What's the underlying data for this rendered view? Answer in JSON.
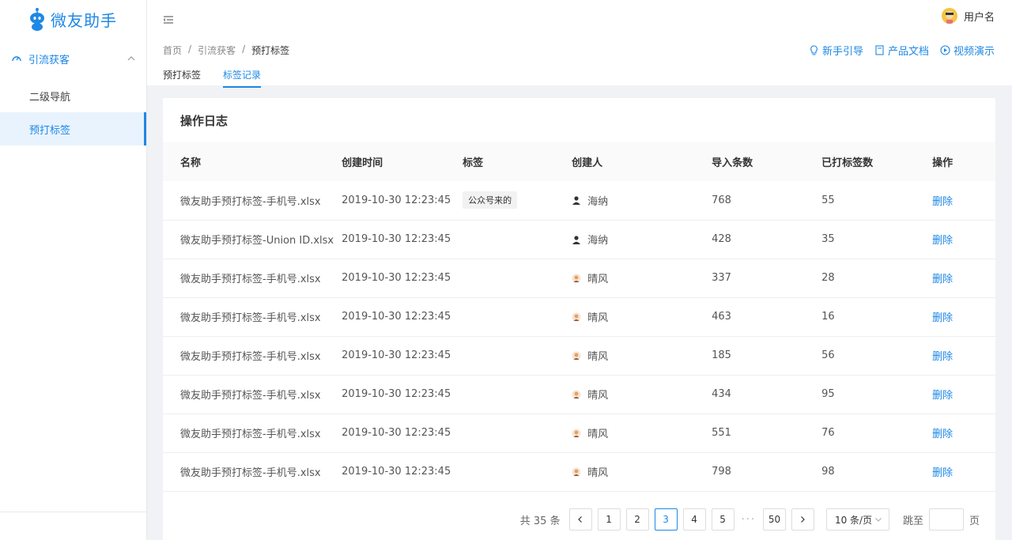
{
  "app": {
    "logo_text": "微友助手",
    "brand_color": "#1e88e5"
  },
  "sidebar": {
    "group": {
      "label": "引流获客",
      "icon": "dashboard-icon",
      "expanded": true
    },
    "items": [
      {
        "label": "二级导航",
        "active": false
      },
      {
        "label": "预打标签",
        "active": true
      }
    ]
  },
  "header": {
    "user_name": "用户名",
    "breadcrumb": [
      "首页",
      "引流获客",
      "预打标签"
    ],
    "help_links": [
      {
        "label": "新手引导",
        "icon": "lightbulb-icon"
      },
      {
        "label": "产品文档",
        "icon": "document-icon"
      },
      {
        "label": "视频演示",
        "icon": "play-icon"
      }
    ],
    "tabs": [
      {
        "label": "预打标签",
        "active": false
      },
      {
        "label": "标签记录",
        "active": true
      }
    ]
  },
  "card": {
    "title": "操作日志",
    "columns": [
      "名称",
      "创建时间",
      "标签",
      "创建人",
      "导入条数",
      "已打标签数",
      "操作"
    ],
    "rows": [
      {
        "name": "微友助手预打标签-手机号.xlsx",
        "time": "2019-10-30 12:23:45",
        "tag": "公众号来的",
        "creator": "海纳",
        "imported": "768",
        "tagged": "55",
        "action": "删除"
      },
      {
        "name": "微友助手预打标签-Union ID.xlsx",
        "time": "2019-10-30 12:23:45",
        "tag": "",
        "creator": "海纳",
        "imported": "428",
        "tagged": "35",
        "action": "删除"
      },
      {
        "name": "微友助手预打标签-手机号.xlsx",
        "time": "2019-10-30 12:23:45",
        "tag": "",
        "creator": "晴风",
        "imported": "337",
        "tagged": "28",
        "action": "删除"
      },
      {
        "name": "微友助手预打标签-手机号.xlsx",
        "time": "2019-10-30 12:23:45",
        "tag": "",
        "creator": "晴风",
        "imported": "463",
        "tagged": "16",
        "action": "删除"
      },
      {
        "name": "微友助手预打标签-手机号.xlsx",
        "time": "2019-10-30 12:23:45",
        "tag": "",
        "creator": "晴风",
        "imported": "185",
        "tagged": "56",
        "action": "删除"
      },
      {
        "name": "微友助手预打标签-手机号.xlsx",
        "time": "2019-10-30 12:23:45",
        "tag": "",
        "creator": "晴风",
        "imported": "434",
        "tagged": "95",
        "action": "删除"
      },
      {
        "name": "微友助手预打标签-手机号.xlsx",
        "time": "2019-10-30 12:23:45",
        "tag": "",
        "creator": "晴风",
        "imported": "551",
        "tagged": "76",
        "action": "删除"
      },
      {
        "name": "微友助手预打标签-手机号.xlsx",
        "time": "2019-10-30 12:23:45",
        "tag": "",
        "creator": "晴风",
        "imported": "798",
        "tagged": "98",
        "action": "删除"
      }
    ]
  },
  "pagination": {
    "total": "共 35 条",
    "pages": [
      "1",
      "2",
      "3",
      "4",
      "5"
    ],
    "current": "3",
    "ellipsis": "···",
    "last": "50",
    "page_size": "10 条/页",
    "jump_label": "跳至",
    "jump_suffix": "页",
    "jump_value": ""
  }
}
